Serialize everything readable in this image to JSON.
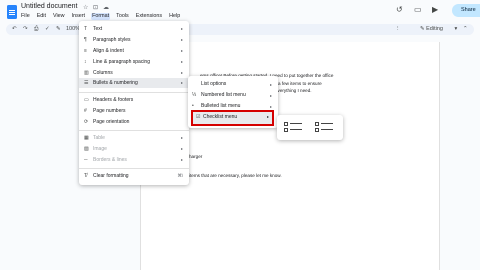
{
  "header": {
    "title": "Untitled document",
    "share_label": "Share"
  },
  "menubar": [
    "File",
    "Edit",
    "View",
    "Insert",
    "Format",
    "Tools",
    "Extensions",
    "Help"
  ],
  "toolbar": {
    "zoom": "100%",
    "mode": "Editing"
  },
  "format_menu": {
    "items": [
      {
        "label": "Text",
        "icon": "T"
      },
      {
        "label": "Paragraph styles",
        "icon": "¶"
      },
      {
        "label": "Align & indent",
        "icon": "≡"
      },
      {
        "label": "Line & paragraph spacing",
        "icon": "↕"
      },
      {
        "label": "Columns",
        "icon": "▥"
      },
      {
        "label": "Bullets & numbering",
        "icon": "☰"
      },
      {
        "label": "Headers & footers",
        "icon": "▭"
      },
      {
        "label": "Page numbers",
        "icon": "#"
      },
      {
        "label": "Page orientation",
        "icon": "⟳"
      },
      {
        "label": "Table",
        "icon": "▦"
      },
      {
        "label": "Image",
        "icon": "▨"
      },
      {
        "label": "Borders & lines",
        "icon": "─"
      },
      {
        "label": "Clear formatting",
        "icon": "T̸",
        "shortcut": "⌘\\"
      }
    ]
  },
  "bullets_menu": {
    "items": [
      {
        "label": "List options"
      },
      {
        "label": "Numbered list menu"
      },
      {
        "label": "Bulleted list menu"
      },
      {
        "label": "Checklist menu"
      }
    ]
  },
  "document": {
    "line1": "ems office! Before getting started, I need to put together the office",
    "line2": "a few items to ensure",
    "line3": "everything I need.",
    "line4": "harger",
    "line5": "items that are necessary, please let me know."
  }
}
